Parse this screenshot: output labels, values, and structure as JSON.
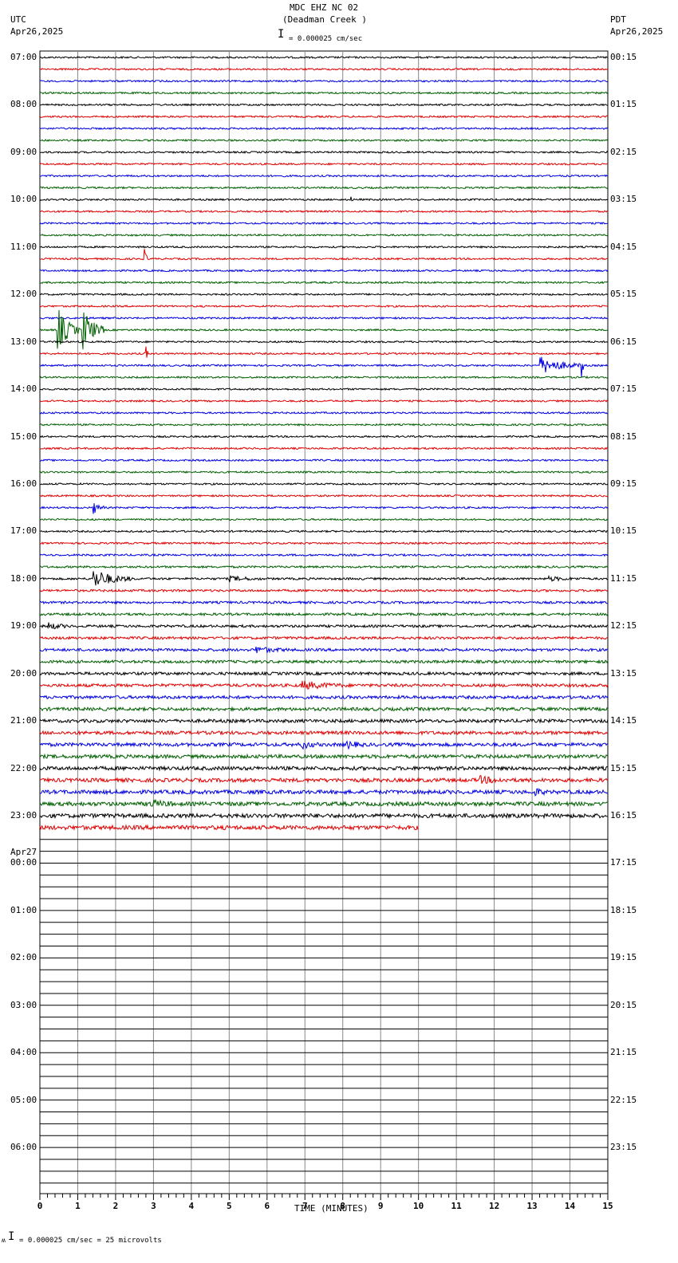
{
  "header": {
    "title": "MDC EHZ NC 02",
    "subtitle": "(Deadman Creek )",
    "scale": "= 0.000025 cm/sec",
    "left_tz": "UTC",
    "left_date": "Apr26,2025",
    "right_tz": "PDT",
    "right_date": "Apr26,2025"
  },
  "footer": {
    "scale": "= 0.000025 cm/sec =      25 microvolts",
    "marker": "ʍ"
  },
  "chart_data": {
    "type": "line",
    "title": "MDC EHZ NC 02 (Deadman Creek )",
    "xlabel": "TIME (MINUTES)",
    "xlim": [
      0,
      15
    ],
    "xticks": [
      "0",
      "1",
      "2",
      "3",
      "4",
      "5",
      "6",
      "7",
      "8",
      "9",
      "10",
      "11",
      "12",
      "13",
      "14",
      "15"
    ],
    "rows_total": 96,
    "rows_with_data": 66,
    "last_row_end_minute": 10,
    "trace_colors": [
      "#000000",
      "#e00000",
      "#0000e0",
      "#006000"
    ],
    "left_labels": [
      "07:00",
      "08:00",
      "09:00",
      "10:00",
      "11:00",
      "12:00",
      "13:00",
      "14:00",
      "15:00",
      "16:00",
      "17:00",
      "18:00",
      "19:00",
      "20:00",
      "21:00",
      "22:00",
      "23:00",
      "00:00",
      "01:00",
      "02:00",
      "03:00",
      "04:00",
      "05:00",
      "06:00"
    ],
    "date_change_label": "Apr27",
    "right_labels": [
      "00:15",
      "01:15",
      "02:15",
      "03:15",
      "04:15",
      "05:15",
      "06:15",
      "07:15",
      "08:15",
      "09:15",
      "10:15",
      "11:15",
      "12:15",
      "13:15",
      "14:15",
      "15:15",
      "16:15",
      "17:15",
      "18:15",
      "19:15",
      "20:15",
      "21:15",
      "22:15",
      "23:15"
    ],
    "events": [
      {
        "row": 12,
        "minute": 8.2,
        "amp": 8,
        "dur": 0.05
      },
      {
        "row": 17,
        "minute": 2.75,
        "amp": 28,
        "dur": 0.05
      },
      {
        "row": 23,
        "minute": 0.45,
        "amp": 60,
        "dur": 0.4
      },
      {
        "row": 23,
        "minute": 1.1,
        "amp": 60,
        "dur": 0.4
      },
      {
        "row": 25,
        "minute": 2.8,
        "amp": 18,
        "dur": 0.05
      },
      {
        "row": 26,
        "minute": 13.2,
        "amp": 22,
        "dur": 0.8
      },
      {
        "row": 26,
        "minute": 14.3,
        "amp": 40,
        "dur": 0.05
      },
      {
        "row": 38,
        "minute": 1.4,
        "amp": 16,
        "dur": 0.2
      },
      {
        "row": 44,
        "minute": 1.4,
        "amp": 25,
        "dur": 0.7
      },
      {
        "row": 44,
        "minute": 5,
        "amp": 6,
        "dur": 0.6
      },
      {
        "row": 44,
        "minute": 13.4,
        "amp": 5,
        "dur": 0.6
      },
      {
        "row": 48,
        "minute": 0.2,
        "amp": 8,
        "dur": 0.4
      },
      {
        "row": 50,
        "minute": 5.7,
        "amp": 7,
        "dur": 0.6
      },
      {
        "row": 53,
        "minute": 6.9,
        "amp": 10,
        "dur": 0.8
      },
      {
        "row": 58,
        "minute": 6.9,
        "amp": 10,
        "dur": 0.3
      },
      {
        "row": 58,
        "minute": 8.1,
        "amp": 9,
        "dur": 0.3
      },
      {
        "row": 61,
        "minute": 11.6,
        "amp": 8,
        "dur": 0.5
      },
      {
        "row": 62,
        "minute": 13.05,
        "amp": 10,
        "dur": 0.2
      },
      {
        "row": 63,
        "minute": 2.9,
        "amp": 8,
        "dur": 0.5
      }
    ]
  }
}
